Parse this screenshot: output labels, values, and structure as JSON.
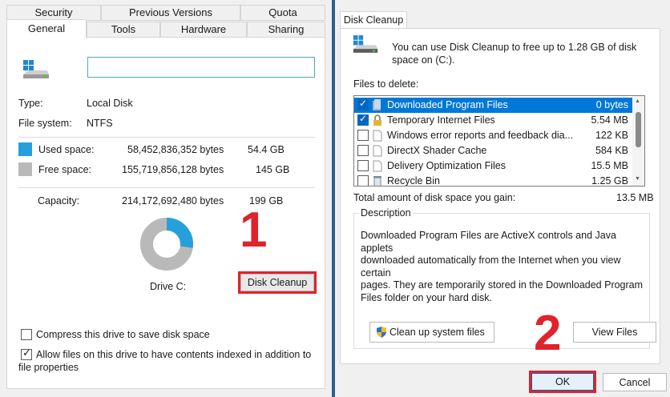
{
  "colors": {
    "used": "#26a0da",
    "free": "#b9b9b9",
    "accent": "#e0222a",
    "selection": "#0078d7"
  },
  "properties": {
    "tabs_top": [
      "Security",
      "Previous Versions",
      "Quota"
    ],
    "tabs_bottom": [
      "General",
      "Tools",
      "Hardware",
      "Sharing"
    ],
    "drive_name_value": "",
    "type_label": "Type:",
    "type_value": "Local Disk",
    "fs_label": "File system:",
    "fs_value": "NTFS",
    "used_label": "Used space:",
    "used_bytes": "58,452,836,352 bytes",
    "used_size": "54.4 GB",
    "free_label": "Free space:",
    "free_bytes": "155,719,856,128 bytes",
    "free_size": "145 GB",
    "capacity_label": "Capacity:",
    "capacity_bytes": "214,172,692,480 bytes",
    "capacity_size": "199 GB",
    "used_fraction": 0.273,
    "drive_label": "Drive C:",
    "cleanup_button": "Disk Cleanup",
    "compress_label": "Compress this drive to save disk space",
    "compress_checked": false,
    "index_label_1": "Allow files on this drive to have contents indexed in addition to",
    "index_label_2": "file properties",
    "index_checked": true,
    "step_1": "1"
  },
  "cleanup": {
    "tab": "Disk Cleanup",
    "intro_1": "You can use Disk Cleanup to free up to 1.28 GB of disk",
    "intro_2": "space on  (C:).",
    "files_label": "Files to delete:",
    "files": [
      {
        "name": "Downloaded Program Files",
        "size": "0 bytes",
        "checked": true,
        "selected": true,
        "icon": "folder-icon"
      },
      {
        "name": "Temporary Internet Files",
        "size": "5.54 MB",
        "checked": true,
        "selected": false,
        "icon": "lock-icon"
      },
      {
        "name": "Windows error reports and feedback dia...",
        "size": "122 KB",
        "checked": false,
        "selected": false,
        "icon": "file-icon"
      },
      {
        "name": "DirectX Shader Cache",
        "size": "584 KB",
        "checked": false,
        "selected": false,
        "icon": "file-icon"
      },
      {
        "name": "Delivery Optimization Files",
        "size": "15.5 MB",
        "checked": false,
        "selected": false,
        "icon": "file-icon"
      },
      {
        "name": "Recycle Bin",
        "size": "1.25 GB",
        "checked": false,
        "selected": false,
        "icon": "recycle-bin-icon"
      }
    ],
    "total_label": "Total amount of disk space you gain:",
    "total_value": "13.5 MB",
    "desc_title": "Description",
    "desc_1": "Downloaded Program Files are ActiveX controls and Java applets",
    "desc_2": "downloaded automatically from the Internet when you view certain",
    "desc_3": "pages. They are temporarily stored in the Downloaded Program",
    "desc_4": "Files folder on your hard disk.",
    "system_button": "Clean up system files",
    "view_button": "View Files",
    "ok_button": "OK",
    "cancel_button": "Cancel",
    "step_2": "2"
  }
}
